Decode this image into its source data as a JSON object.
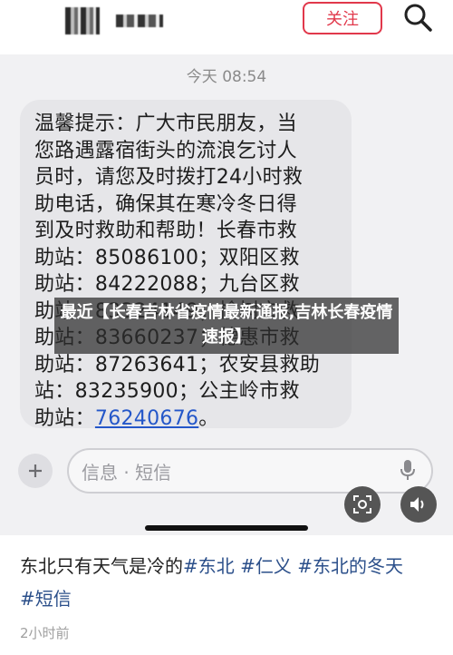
{
  "header": {
    "follow_label": "关注",
    "icons": {
      "search": "search-icon"
    }
  },
  "sms": {
    "time": "今天 08:54",
    "message_body": "温馨提示：广大市民朋友，当\n您路遇露宿街头的流浪乞讨人\n员时，请您及时拨打24小时救\n助电话，确保其在寒冷冬日得\n到及时救助和帮助！长春市救\n助站：85086100；双阳区救\n助站：84222088；九台区救\n助站：83324149；榆树市救\n助站：83660237；德惠市救\n助站：87263641；农安县救助\n站：83235900；公主岭市救\n助站：",
    "link_number": "76240676",
    "tail": "。",
    "input_placeholder": "信息 · 短信",
    "icons": {
      "plus": "plus-icon",
      "mic": "microphone-icon",
      "scan": "scan-icon",
      "sound": "speaker-icon"
    }
  },
  "overlay": {
    "text": "最近【长春吉林省疫情最新通报,吉林长春疫情速报】"
  },
  "caption": {
    "text": "东北只有天气是冷的",
    "tags": [
      "#东北",
      "#仁义",
      "#东北的冬天",
      "#短信"
    ],
    "post_time": "2小时前"
  },
  "colors": {
    "accent": "#e1384b",
    "link": "#2457c9",
    "tag": "#2b4f8a"
  }
}
